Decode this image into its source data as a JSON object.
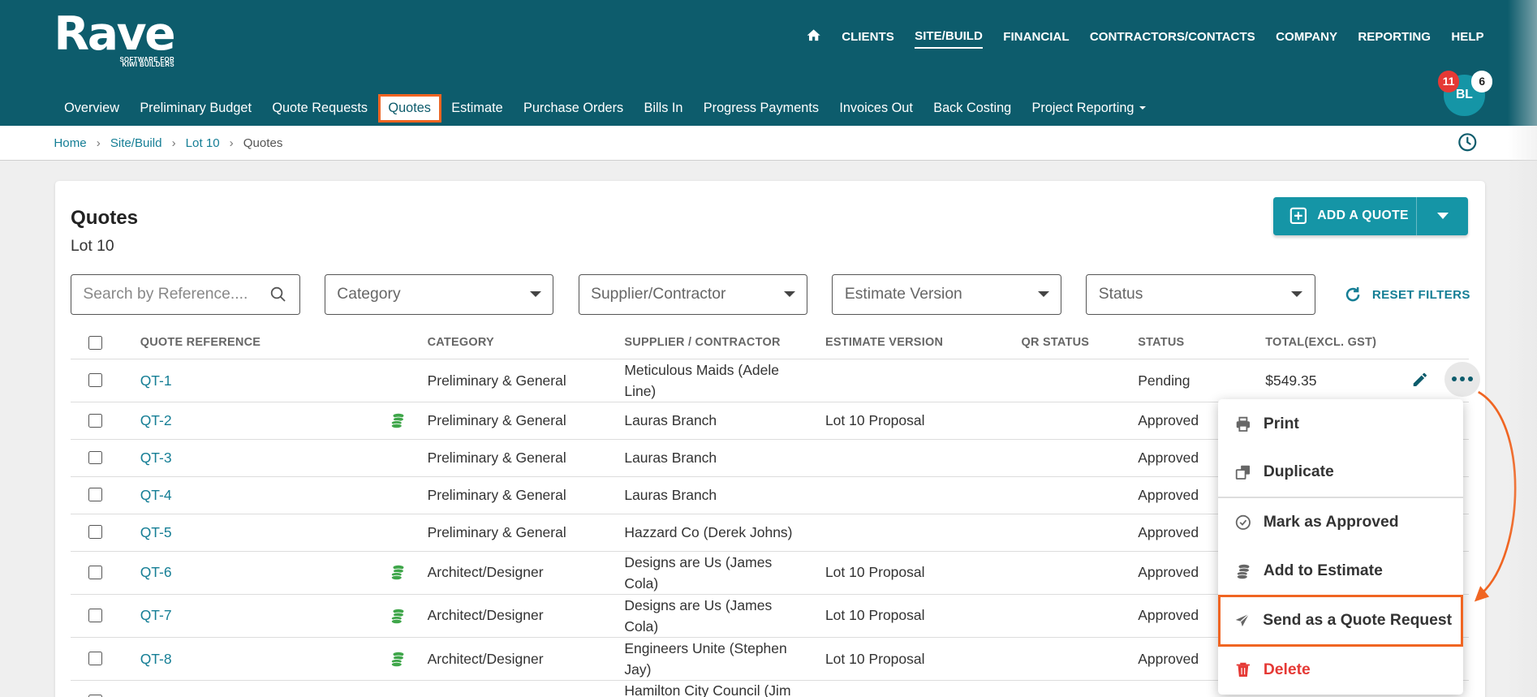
{
  "app": {
    "brand": "Rave",
    "tagline_1": "SOFTWARE FOR",
    "tagline_2": "KIWI BUILDERS"
  },
  "topnav": [
    "CLIENTS",
    "SITE/BUILD",
    "FINANCIAL",
    "CONTRACTORS/CONTACTS",
    "COMPANY",
    "REPORTING",
    "HELP"
  ],
  "subnav": [
    "Overview",
    "Preliminary Budget",
    "Quote Requests",
    "Quotes",
    "Estimate",
    "Purchase Orders",
    "Bills In",
    "Progress Payments",
    "Invoices Out",
    "Back Costing",
    "Project Reporting"
  ],
  "user": {
    "initials": "BL",
    "notifications": "11",
    "messages": "6"
  },
  "breadcrumb": [
    "Home",
    "Site/Build",
    "Lot 10",
    "Quotes"
  ],
  "page": {
    "title": "Quotes",
    "subtitle": "Lot 10",
    "add_button": "ADD A QUOTE"
  },
  "filters": {
    "search_placeholder": "Search by Reference....",
    "category": "Category",
    "supplier": "Supplier/Contractor",
    "estimate_version": "Estimate Version",
    "status": "Status",
    "reset": "RESET FILTERS"
  },
  "table": {
    "headers": [
      "QUOTE REFERENCE",
      "CATEGORY",
      "SUPPLIER / CONTRACTOR",
      "ESTIMATE VERSION",
      "QR STATUS",
      "STATUS",
      "TOTAL(EXCL. GST)"
    ],
    "rows": [
      {
        "ref": "QT-1",
        "category": "Preliminary & General",
        "supplier_1": "Meticulous Maids (Adele",
        "supplier_2": "Line)",
        "estimate": "",
        "status": "Pending",
        "total": "$549.35"
      },
      {
        "ref": "QT-2",
        "category": "Preliminary & General",
        "supplier_1": "Lauras Branch",
        "supplier_2": "",
        "estimate": "Lot 10 Proposal",
        "status": "Approved",
        "total": ""
      },
      {
        "ref": "QT-3",
        "category": "Preliminary & General",
        "supplier_1": "Lauras Branch",
        "supplier_2": "",
        "estimate": "",
        "status": "Approved",
        "total": ""
      },
      {
        "ref": "QT-4",
        "category": "Preliminary & General",
        "supplier_1": "Lauras Branch",
        "supplier_2": "",
        "estimate": "",
        "status": "Approved",
        "total": ""
      },
      {
        "ref": "QT-5",
        "category": "Preliminary & General",
        "supplier_1": "Hazzard Co (Derek Johns)",
        "supplier_2": "",
        "estimate": "",
        "status": "Approved",
        "total": ""
      },
      {
        "ref": "QT-6",
        "category": "Architect/Designer",
        "supplier_1": "Designs are Us (James",
        "supplier_2": "Cola)",
        "estimate": "Lot 10 Proposal",
        "status": "Approved",
        "total": ""
      },
      {
        "ref": "QT-7",
        "category": "Architect/Designer",
        "supplier_1": "Designs are Us (James",
        "supplier_2": "Cola)",
        "estimate": "Lot 10 Proposal",
        "status": "Approved",
        "total": ""
      },
      {
        "ref": "QT-8",
        "category": "Architect/Designer",
        "supplier_1": "Engineers Unite (Stephen",
        "supplier_2": "Jay)",
        "estimate": "Lot 10 Proposal",
        "status": "Approved",
        "total": ""
      },
      {
        "ref": "",
        "category": "",
        "supplier_1": "Hamilton City Council (Jim",
        "supplier_2": "",
        "estimate": "",
        "status": "",
        "total": ""
      }
    ]
  },
  "menu": [
    "Print",
    "Duplicate",
    "Mark as Approved",
    "Add to Estimate",
    "Send as a Quote Request",
    "Delete"
  ],
  "colors": {
    "header": "#0d5c6c",
    "accent": "#1595a6",
    "highlight": "#f06522",
    "danger": "#e53935",
    "estimate_icon": "#3fa64a"
  }
}
